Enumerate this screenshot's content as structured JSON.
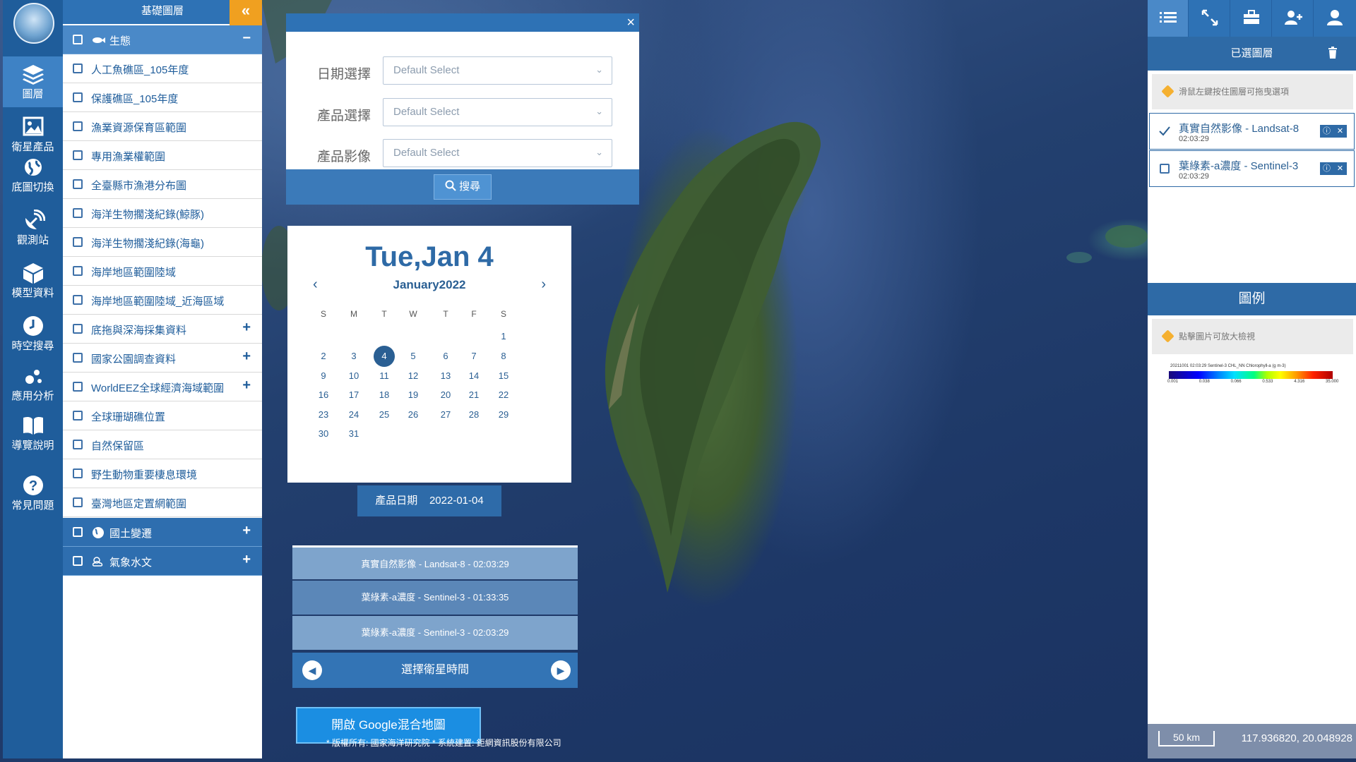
{
  "nav": {
    "items": [
      {
        "label": "圖層",
        "icon": "layers-icon"
      },
      {
        "label": "衛星產品",
        "icon": "image-icon"
      },
      {
        "label": "底圖切換",
        "icon": "globe-icon"
      },
      {
        "label": "觀測站",
        "icon": "satellite-dish-icon"
      },
      {
        "label": "模型資料",
        "icon": "cube-icon"
      },
      {
        "label": "時空搜尋",
        "icon": "clock-icon"
      },
      {
        "label": "應用分析",
        "icon": "analysis-icon"
      },
      {
        "label": "導覽說明",
        "icon": "book-icon"
      },
      {
        "label": "常見問題",
        "icon": "question-icon"
      }
    ]
  },
  "layer_panel": {
    "title": "基礎圖層",
    "collapse_icon": "double-chevron-left-icon",
    "category_ecology": {
      "label": "生態",
      "toggle": "−"
    },
    "items": [
      {
        "label": "人工魚礁區_105年度"
      },
      {
        "label": "保護礁區_105年度"
      },
      {
        "label": "漁業資源保育區範圍"
      },
      {
        "label": "專用漁業權範圍"
      },
      {
        "label": "全臺縣市漁港分布圖"
      },
      {
        "label": "海洋生物擱淺紀錄(鯨豚)"
      },
      {
        "label": "海洋生物擱淺紀錄(海龜)"
      },
      {
        "label": "海岸地區範圍陸域"
      },
      {
        "label": "海岸地區範圍陸域_近海區域"
      },
      {
        "label": "底拖與深海採集資料",
        "toggle": "+"
      },
      {
        "label": "國家公園調查資料",
        "toggle": "+"
      },
      {
        "label": "WorldEEZ全球經濟海域範圍",
        "toggle": "+"
      },
      {
        "label": "全球珊瑚礁位置"
      },
      {
        "label": "自然保留區"
      },
      {
        "label": "野生動物重要棲息環境"
      },
      {
        "label": "臺灣地區定置網範圍"
      }
    ],
    "category_land": {
      "label": "國土變遷",
      "toggle": "+"
    },
    "category_weather": {
      "label": "氣象水文",
      "toggle": "+"
    }
  },
  "search": {
    "close": "×",
    "date_label": "日期選擇",
    "product_label": "產品選擇",
    "image_label": "產品影像",
    "placeholder": "Default Select",
    "button": "搜尋"
  },
  "calendar": {
    "big_date": "Tue,Jan 4",
    "month": "January2022",
    "dow": [
      "S",
      "M",
      "T",
      "W",
      "T",
      "F",
      "S"
    ],
    "selected_day": 4
  },
  "product_date": {
    "label": "產品日期",
    "value": "2022-01-04"
  },
  "sat_times": {
    "rows": [
      "真實自然影像 - Landsat-8 - 02:03:29",
      "葉綠素-a濃度 - Sentinel-3 - 01:33:35",
      "葉綠素-a濃度 - Sentinel-3 - 02:03:29"
    ],
    "footer": "選擇衛星時間"
  },
  "google_button": "開啟 Google混合地圖",
  "copyright": "* 版權所有: 國家海洋研究院 * 系統建置: 鉅網資訊股份有限公司",
  "right_panel": {
    "selected_title": "已選圖層",
    "drag_hint": "滑鼠左鍵按住圖層可拖曳選項",
    "layers": [
      {
        "name": "真實自然影像 - Landsat-8",
        "time": "02:03:29",
        "checked": true
      },
      {
        "name": "葉綠素-a濃度 - Sentinel-3",
        "time": "02:03:29",
        "checked": false
      }
    ],
    "legend_title": "圖例",
    "legend_hint": "點擊圖片可放大檢視",
    "legend_caption": "20211001     02:03:29     Sentinel-3 CHL_NN Chlorophyll-a (g m-3)",
    "legend_ticks": [
      "0.001",
      "0.038",
      "0.066",
      "0.533",
      "4.316",
      "35.000"
    ]
  },
  "scale": "50 km",
  "coords": "117.936820, 20.048928"
}
